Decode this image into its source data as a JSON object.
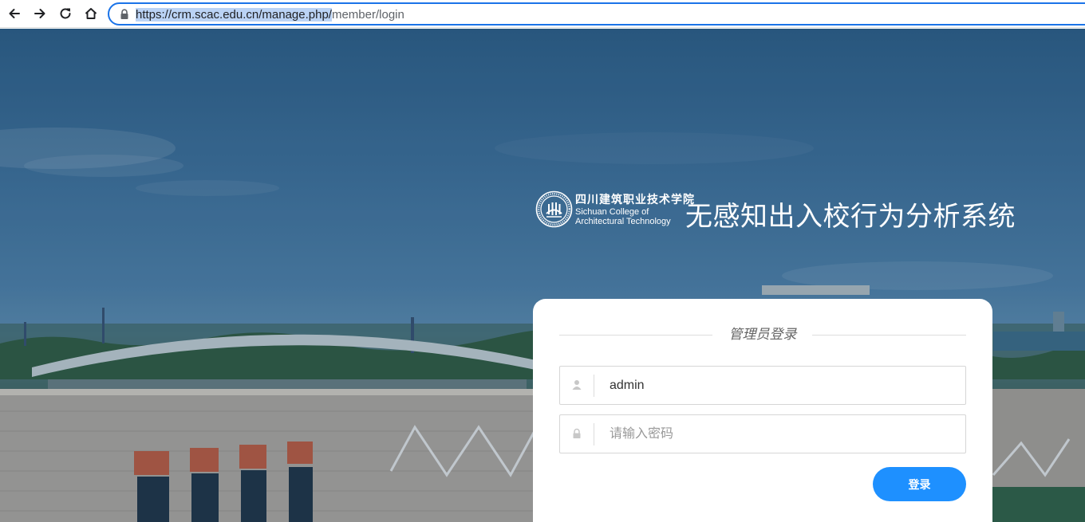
{
  "browser": {
    "url_selected": "https://crm.scac.edu.cn/manage.php/",
    "url_rest": "member/login",
    "icons": [
      "back-icon",
      "forward-icon",
      "reload-icon",
      "home-icon",
      "lock-icon"
    ]
  },
  "brand": {
    "school_cn": "四川建筑职业技术学院",
    "school_en_line1": "Sichuan College of",
    "school_en_line2": "Architectural Technology",
    "system_title": "无感知出入校行为分析系统"
  },
  "login": {
    "title": "管理员登录",
    "username_value": "admin",
    "password_placeholder": "请输入密码",
    "submit_label": "登录",
    "accent": "#1e90ff"
  }
}
